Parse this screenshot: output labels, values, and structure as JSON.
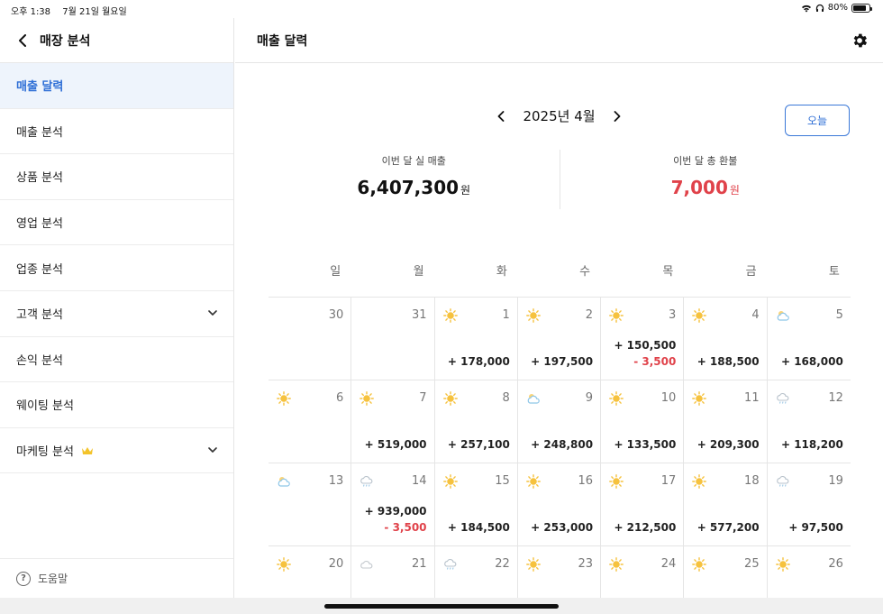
{
  "status_bar": {
    "time": "오후 1:38",
    "date": "7월 21일 월요일",
    "battery": "80%",
    "battery_level": 0.8
  },
  "sidebar": {
    "title": "매장 분석",
    "items": [
      {
        "label": "매출 달력",
        "active": true,
        "expandable": false,
        "crown": false
      },
      {
        "label": "매출 분석",
        "active": false,
        "expandable": false,
        "crown": false
      },
      {
        "label": "상품 분석",
        "active": false,
        "expandable": false,
        "crown": false
      },
      {
        "label": "영업 분석",
        "active": false,
        "expandable": false,
        "crown": false
      },
      {
        "label": "업종 분석",
        "active": false,
        "expandable": false,
        "crown": false
      },
      {
        "label": "고객 분석",
        "active": false,
        "expandable": true,
        "crown": false
      },
      {
        "label": "손익 분석",
        "active": false,
        "expandable": false,
        "crown": false
      },
      {
        "label": "웨이팅 분석",
        "active": false,
        "expandable": false,
        "crown": false
      },
      {
        "label": "마케팅 분석",
        "active": false,
        "expandable": true,
        "crown": true
      }
    ],
    "help_label": "도움말"
  },
  "main": {
    "title": "매출 달력",
    "month_label": "2025년 4월",
    "today_button": "오늘",
    "summary": {
      "sales_label": "이번 달 실 매출",
      "sales_value": "6,407,300",
      "refund_label": "이번 달 총 환불",
      "refund_value": "7,000",
      "unit": "원"
    },
    "weekdays": [
      "일",
      "월",
      "화",
      "수",
      "목",
      "금",
      "토"
    ],
    "weeks": [
      [
        {
          "day": "30",
          "weather": "",
          "amount": "",
          "refund": ""
        },
        {
          "day": "31",
          "weather": "",
          "amount": "",
          "refund": ""
        },
        {
          "day": "1",
          "weather": "sunny",
          "amount": "+ 178,000",
          "refund": ""
        },
        {
          "day": "2",
          "weather": "sunny",
          "amount": "+ 197,500",
          "refund": ""
        },
        {
          "day": "3",
          "weather": "sunny",
          "amount": "+ 150,500",
          "refund": "- 3,500"
        },
        {
          "day": "4",
          "weather": "sunny",
          "amount": "+ 188,500",
          "refund": ""
        },
        {
          "day": "5",
          "weather": "cloudy",
          "amount": "+ 168,000",
          "refund": ""
        }
      ],
      [
        {
          "day": "6",
          "weather": "sunny",
          "amount": "",
          "refund": ""
        },
        {
          "day": "7",
          "weather": "sunny",
          "amount": "+ 519,000",
          "refund": ""
        },
        {
          "day": "8",
          "weather": "sunny",
          "amount": "+ 257,100",
          "refund": ""
        },
        {
          "day": "9",
          "weather": "cloudy",
          "amount": "+ 248,800",
          "refund": ""
        },
        {
          "day": "10",
          "weather": "sunny",
          "amount": "+ 133,500",
          "refund": ""
        },
        {
          "day": "11",
          "weather": "sunny",
          "amount": "+ 209,300",
          "refund": ""
        },
        {
          "day": "12",
          "weather": "rain",
          "amount": "+ 118,200",
          "refund": ""
        }
      ],
      [
        {
          "day": "13",
          "weather": "cloudy",
          "amount": "",
          "refund": ""
        },
        {
          "day": "14",
          "weather": "rain",
          "amount": "+ 939,000",
          "refund": "- 3,500"
        },
        {
          "day": "15",
          "weather": "sunny",
          "amount": "+ 184,500",
          "refund": ""
        },
        {
          "day": "16",
          "weather": "sunny",
          "amount": "+ 253,000",
          "refund": ""
        },
        {
          "day": "17",
          "weather": "sunny",
          "amount": "+ 212,500",
          "refund": ""
        },
        {
          "day": "18",
          "weather": "sunny",
          "amount": "+ 577,200",
          "refund": ""
        },
        {
          "day": "19",
          "weather": "rain",
          "amount": "+ 97,500",
          "refund": ""
        }
      ],
      [
        {
          "day": "20",
          "weather": "sunny",
          "amount": "",
          "refund": ""
        },
        {
          "day": "21",
          "weather": "cloud-gray",
          "amount": "",
          "refund": ""
        },
        {
          "day": "22",
          "weather": "rain",
          "amount": "",
          "refund": ""
        },
        {
          "day": "23",
          "weather": "sunny",
          "amount": "",
          "refund": ""
        },
        {
          "day": "24",
          "weather": "sunny",
          "amount": "",
          "refund": ""
        },
        {
          "day": "25",
          "weather": "sunny",
          "amount": "",
          "refund": ""
        },
        {
          "day": "26",
          "weather": "sunny",
          "amount": "",
          "refund": ""
        }
      ]
    ]
  },
  "colors": {
    "accent": "#2f6fd6",
    "refund": "#e0424a",
    "sun": "#f6c23e",
    "cloud": "#8ec6e8"
  }
}
